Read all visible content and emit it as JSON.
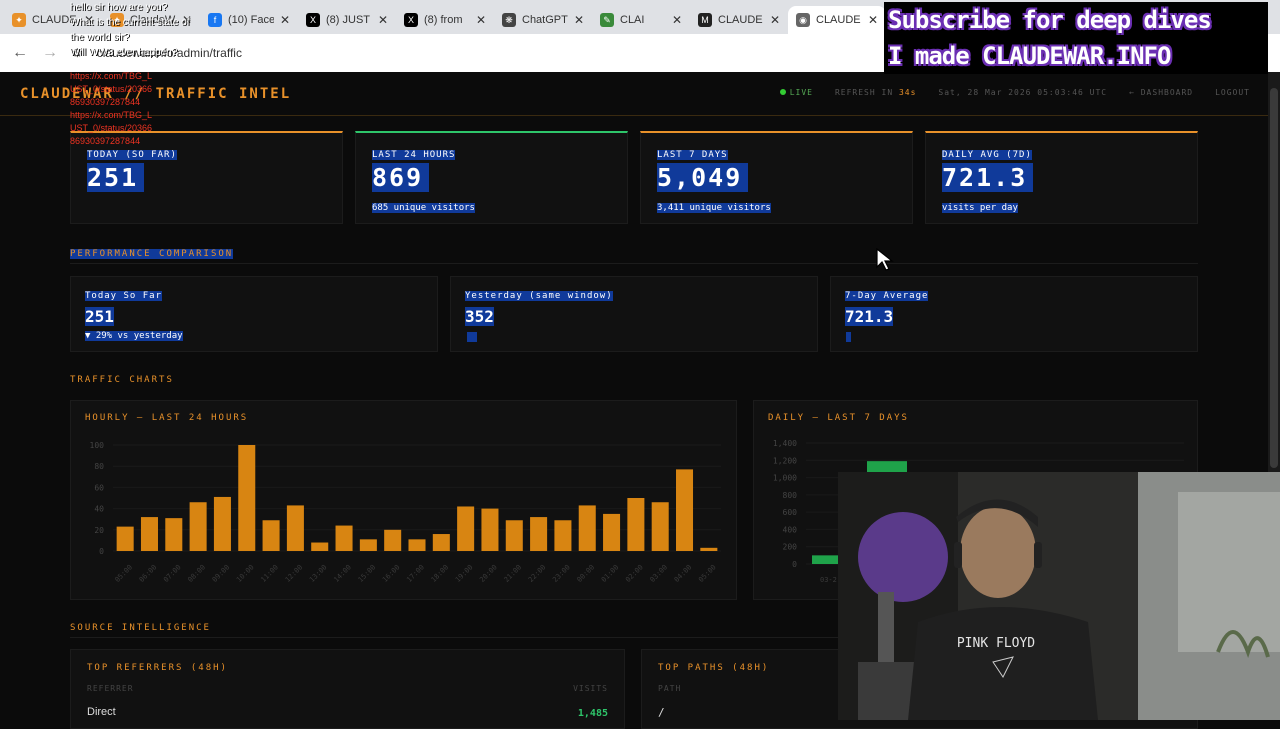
{
  "browser": {
    "tabs": [
      {
        "title": "CLAUDE",
        "fav_color": "#e8912a",
        "fav_glyph": "✦"
      },
      {
        "title": "ClaudeW",
        "fav_color": "#e8912a",
        "fav_glyph": "✦"
      },
      {
        "title": "(10) Face",
        "fav_color": "#1877f2",
        "fav_glyph": "f"
      },
      {
        "title": "(8) JUST",
        "fav_color": "#000000",
        "fav_glyph": "X"
      },
      {
        "title": "(8) from",
        "fav_color": "#000000",
        "fav_glyph": "X"
      },
      {
        "title": "ChatGPT",
        "fav_color": "#444444",
        "fav_glyph": "❋"
      },
      {
        "title": "CLAI",
        "fav_color": "#3a8a3a",
        "fav_glyph": "✎"
      },
      {
        "title": "CLAUDE",
        "fav_color": "#222222",
        "fav_glyph": "M"
      },
      {
        "title": "CLAUDE",
        "fav_color": "#666666",
        "fav_glyph": "◉",
        "active": true
      }
    ],
    "url": "claudewar.info/admin/traffic"
  },
  "banner": {
    "line1": "Subscribe for deep dives",
    "line2": "I made CLAUDEWAR.INFO"
  },
  "chat_overlay": {
    "messages": [
      "hello sir how are you?",
      "What is the current state of the world sir?",
      "Will WW3 ever happen?"
    ],
    "links": [
      "https://x.com/TBG_L",
      "UST_0/status/20366",
      "86930397287844",
      "https://x.com/TBG_L",
      "UST_0/status/20366",
      "86930397287844"
    ]
  },
  "header": {
    "logo": "CLAUDEWAR // TRAFFIC INTEL",
    "live": "LIVE",
    "refresh_label": "REFRESH IN",
    "refresh_count": "34s",
    "timestamp": "Sat, 28 Mar 2026 05:03:46 UTC",
    "dashboard": "← DASHBOARD",
    "logout": "LOGOUT"
  },
  "stats": [
    {
      "label": "TODAY (SO FAR)",
      "value": "251",
      "sub": "",
      "accent": "#e8912a"
    },
    {
      "label": "LAST 24 HOURS",
      "value": "869",
      "sub": "685 unique visitors",
      "accent": "#2ec56a"
    },
    {
      "label": "LAST 7 DAYS",
      "value": "5,049",
      "sub": "3,411 unique visitors",
      "accent": "#e8912a"
    },
    {
      "label": "DAILY AVG (7D)",
      "value": "721.3",
      "sub": "visits per day",
      "accent": "#e8912a"
    }
  ],
  "performance": {
    "title": "PERFORMANCE COMPARISON",
    "items": [
      {
        "label": "Today So Far",
        "value": "251",
        "sub": "▼ 29% vs yesterday"
      },
      {
        "label": "Yesterday (same window)",
        "value": "352",
        "sub": ""
      },
      {
        "label": "7-Day Average",
        "value": "721.3",
        "sub": ""
      }
    ]
  },
  "traffic_section_title": "TRAFFIC CHARTS",
  "source_section_title": "SOURCE INTELLIGENCE",
  "chart_data": [
    {
      "type": "bar",
      "title": "HOURLY — LAST 24 HOURS",
      "categories": [
        "05:00",
        "06:00",
        "07:00",
        "08:00",
        "09:00",
        "10:00",
        "11:00",
        "12:00",
        "13:00",
        "14:00",
        "15:00",
        "16:00",
        "17:00",
        "18:00",
        "19:00",
        "20:00",
        "21:00",
        "22:00",
        "23:00",
        "00:00",
        "01:00",
        "02:00",
        "03:00",
        "04:00",
        "05:00"
      ],
      "values": [
        23,
        32,
        31,
        46,
        51,
        100,
        29,
        43,
        8,
        24,
        11,
        20,
        11,
        16,
        42,
        40,
        29,
        32,
        29,
        43,
        35,
        50,
        46,
        77,
        3
      ],
      "ylim": [
        0,
        100
      ],
      "yticks": [
        0,
        20,
        40,
        60,
        80,
        100
      ],
      "color": "#d88512"
    },
    {
      "type": "bar",
      "title": "DAILY — LAST 7 DAYS",
      "yticks": [
        0,
        200,
        400,
        600,
        800,
        1000,
        1200,
        1400
      ],
      "ylim": [
        0,
        1400
      ],
      "first_tick_label": "03-2",
      "values": [
        100,
        1190
      ],
      "color": "#1fa34a"
    }
  ],
  "tables": {
    "referrers": {
      "title": "TOP REFERRERS (48H)",
      "col1": "REFERRER",
      "col2": "VISITS",
      "rows": [
        {
          "name": "Direct",
          "visits": "1,485"
        }
      ]
    },
    "paths": {
      "title": "TOP PATHS (48H)",
      "col1": "PATH",
      "rows": [
        {
          "name": "/"
        }
      ]
    }
  },
  "webcam": {
    "shirt_text": "PINK FLOYD"
  }
}
